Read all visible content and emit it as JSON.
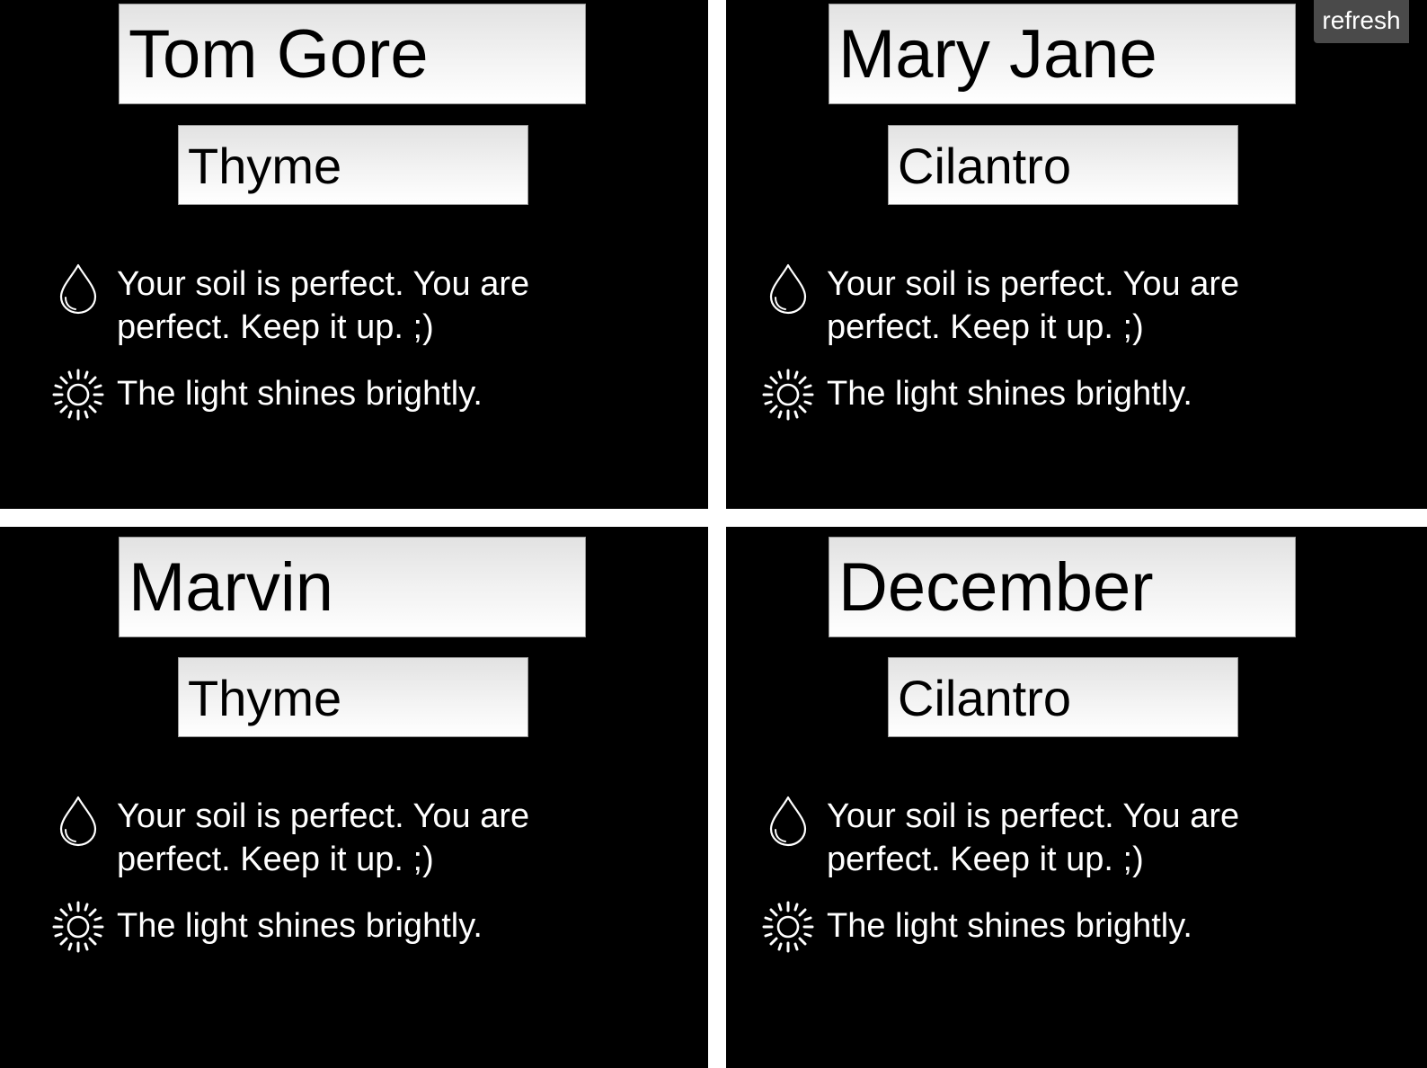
{
  "refresh_button": {
    "label": "refresh"
  },
  "panels": [
    {
      "name": "Tom Gore",
      "plant": "Thyme",
      "soil_status": "Your soil is perfect. You are perfect. Keep it up. ;)",
      "light_status": "The light shines brightly.",
      "soil_icon": "water-drop-icon",
      "light_icon": "sun-icon"
    },
    {
      "name": "Mary Jane",
      "plant": "Cilantro",
      "soil_status": "Your soil is perfect. You are perfect. Keep it up. ;)",
      "light_status": "The light shines brightly.",
      "soil_icon": "water-drop-icon",
      "light_icon": "sun-icon"
    },
    {
      "name": "Marvin",
      "plant": "Thyme",
      "soil_status": "Your soil is perfect. You are perfect. Keep it up. ;)",
      "light_status": "The light shines brightly.",
      "soil_icon": "water-drop-icon",
      "light_icon": "sun-icon"
    },
    {
      "name": "December",
      "plant": "Cilantro",
      "soil_status": "Your soil is perfect. You are perfect. Keep it up. ;)",
      "light_status": "The light shines brightly.",
      "soil_icon": "water-drop-icon",
      "light_icon": "sun-icon"
    }
  ],
  "colors": {
    "panel_background": "#000000",
    "divider": "#ffffff",
    "status_text": "#ffffff",
    "refresh_background": "#4a4a4a"
  }
}
